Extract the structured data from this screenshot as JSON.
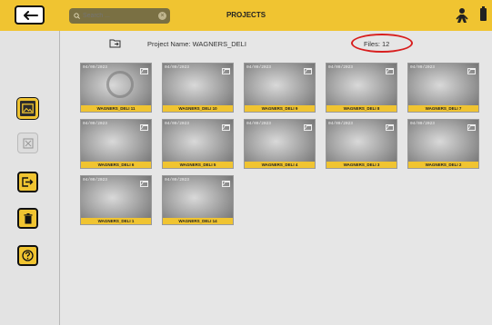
{
  "header": {
    "title": "PROJECTS",
    "search_placeholder": "Search ...",
    "accent_color": "#f0c431"
  },
  "info": {
    "project_name": "Project Name: WAGNERS_DELI",
    "files_count": "Files: 12"
  },
  "sidebar": {
    "items": [
      {
        "name": "gallery",
        "icon": "image-icon"
      },
      {
        "name": "delete-image",
        "icon": "image-x-icon"
      },
      {
        "name": "export",
        "icon": "export-icon"
      },
      {
        "name": "delete",
        "icon": "trash-icon"
      },
      {
        "name": "help",
        "icon": "help-icon"
      }
    ]
  },
  "thumbnails": [
    {
      "date": "04/09/2023",
      "label": "WAGNERS_DELI 11"
    },
    {
      "date": "04/09/2023",
      "label": "WAGNERS_DELI 10"
    },
    {
      "date": "04/09/2023",
      "label": "WAGNERS_DELI 9"
    },
    {
      "date": "04/09/2023",
      "label": "WAGNERS_DELI 8"
    },
    {
      "date": "04/09/2023",
      "label": "WAGNERS_DELI 7"
    },
    {
      "date": "04/09/2023",
      "label": "WAGNERS_DELI 6"
    },
    {
      "date": "04/09/2023",
      "label": "WAGNERS_DELI 5"
    },
    {
      "date": "04/09/2023",
      "label": "WAGNERS_DELI 4"
    },
    {
      "date": "04/09/2023",
      "label": "WAGNERS_DELI 3"
    },
    {
      "date": "04/09/2023",
      "label": "WAGNERS_DELI 2"
    },
    {
      "date": "04/09/2023",
      "label": "WAGNERS_DELI 1"
    },
    {
      "date": "04/09/2023",
      "label": "WAGNERS_DELI 14"
    }
  ]
}
